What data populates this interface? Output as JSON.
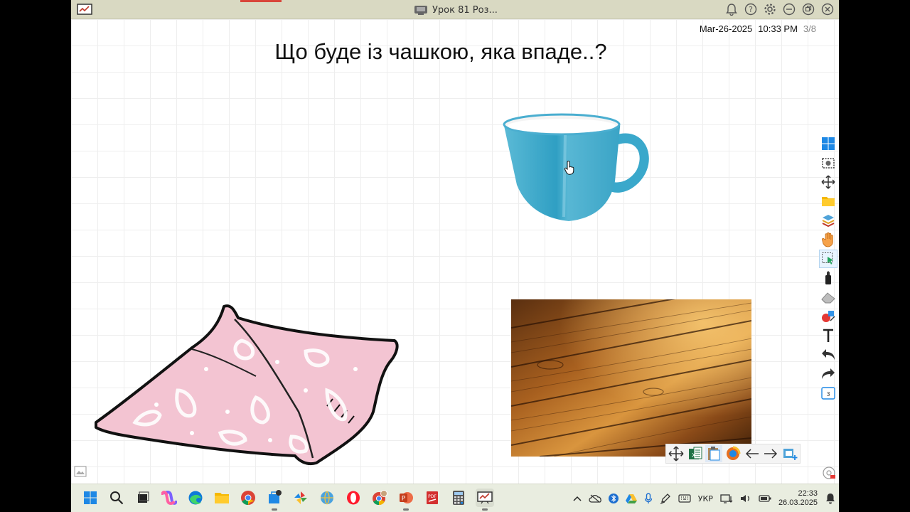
{
  "window": {
    "title": "Урок 81 Роз...",
    "icons": [
      "bell-icon",
      "help-icon",
      "gear-icon",
      "minimize-icon",
      "restore-icon",
      "close-icon"
    ]
  },
  "canvas": {
    "date": "Mar-26-2025",
    "time": "10:33 PM",
    "page": "3/8",
    "title": "Що буде із чашкою, яка впаде..?"
  },
  "side_toolbar": [
    "windows-icon",
    "screenshot-icon",
    "move-icon",
    "folder-icon",
    "layers-icon",
    "hand-icon",
    "select-icon",
    "pen-icon",
    "eraser-icon",
    "shapes-icon",
    "text-icon",
    "undo-icon",
    "redo-icon",
    "page-count-icon"
  ],
  "side_toolbar_page_badge": "3",
  "float_toolbar": [
    "move-icon",
    "sheet-icon",
    "clipboard-icon",
    "browser-icon",
    "arrow-left-icon",
    "arrow-right-icon",
    "add-page-icon"
  ],
  "taskbar": {
    "apps": [
      "start-icon",
      "search-icon",
      "task-view-icon",
      "copilot-icon",
      "edge-icon",
      "explorer-icon",
      "chrome-icon",
      "store-icon",
      "pinwheel-icon",
      "globe-icon",
      "opera-icon",
      "chrome-profile-icon",
      "powerpoint-icon",
      "pdf-icon",
      "calculator-icon",
      "whiteboard-icon"
    ],
    "language": "УКР",
    "time": "22:33",
    "date": "26.03.2025"
  },
  "colors": {
    "titlebar": "#d9d9c2",
    "taskbar": "#e9ede0",
    "cup": "#3fa9c9",
    "pillow": "#f3c4d2"
  }
}
